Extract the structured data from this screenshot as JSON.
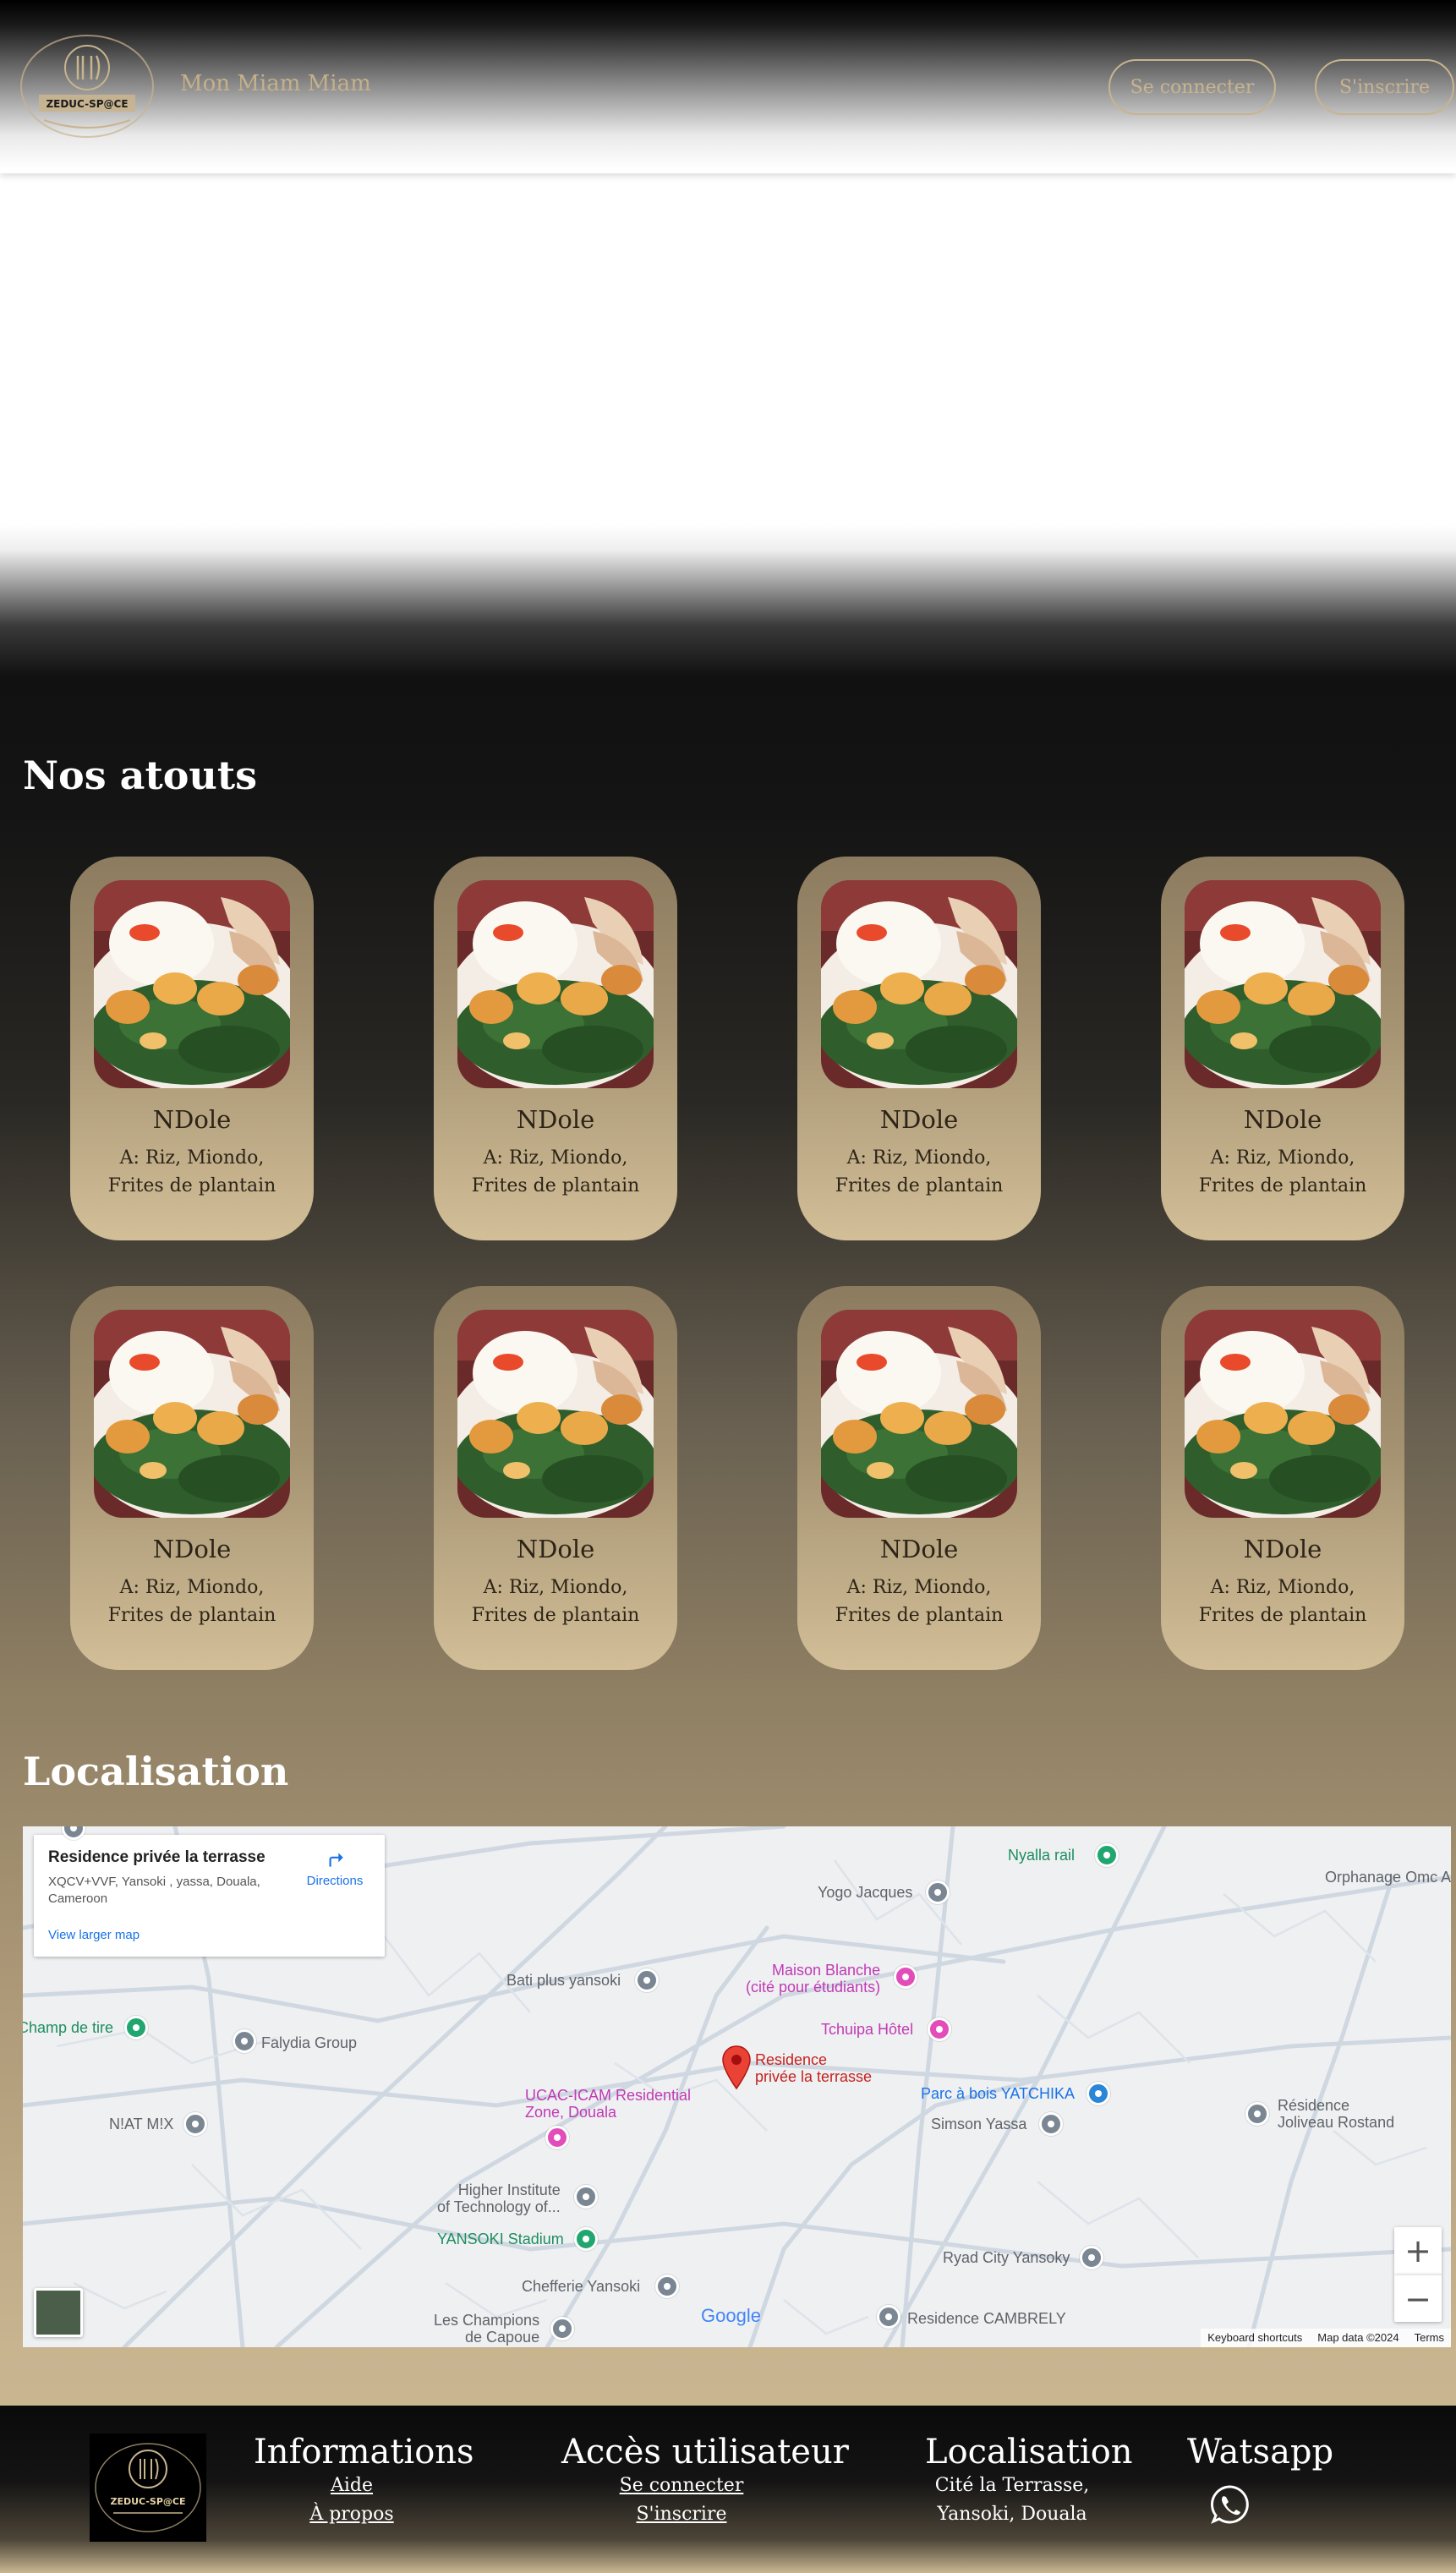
{
  "header": {
    "logo_text": "ZEDUC-SP@CE",
    "brand": "Mon Miam Miam",
    "login_label": "Se connecter",
    "signup_label": "S'inscrire"
  },
  "atouts": {
    "title": "Nos atouts",
    "cards": [
      {
        "name": "NDole",
        "desc": "A: Riz, Miondo, Frites de plantain"
      },
      {
        "name": "NDole",
        "desc": "A: Riz, Miondo, Frites de plantain"
      },
      {
        "name": "NDole",
        "desc": "A: Riz, Miondo, Frites de plantain"
      },
      {
        "name": "NDole",
        "desc": "A: Riz, Miondo, Frites de plantain"
      },
      {
        "name": "NDole",
        "desc": "A: Riz, Miondo, Frites de plantain"
      },
      {
        "name": "NDole",
        "desc": "A: Riz, Miondo, Frites de plantain"
      },
      {
        "name": "NDole",
        "desc": "A: Riz, Miondo, Frites de plantain"
      },
      {
        "name": "NDole",
        "desc": "A: Riz, Miondo, Frites de plantain"
      }
    ]
  },
  "localisation": {
    "title": "Localisation",
    "map": {
      "place_title": "Residence privée la terrasse",
      "place_address": "XQCV+VVF, Yansoki , yassa, Douala, Cameroon",
      "larger_map": "View larger map",
      "directions": "Directions",
      "marker_label_1": "Residence",
      "marker_label_2": "privée la terrasse",
      "pois": {
        "nyalla": "Nyalla rail",
        "yogo": "Yogo Jacques",
        "orphanage": "Orphanage Omc A",
        "bati": "Bati plus yansoki",
        "maison1": "Maison Blanche",
        "maison2": "(cité pour étudiants)",
        "tchuipa": "Tchuipa Hôtel",
        "champ": "Champ de tire",
        "falydia": "Falydia Group",
        "ucac1": "UCAC-ICAM Residential",
        "ucac2": "Zone, Douala",
        "parc": "Parc à bois YATCHIKA",
        "simson": "Simson Yassa",
        "joliveau1": "Résidence",
        "joliveau2": "Joliveau Rostand",
        "niatmix": "N!AT M!X",
        "higher1": "Higher Institute",
        "higher2": "of Technology of...",
        "yansoki": "YANSOKI Stadium",
        "ryad": "Ryad City Yansoky",
        "chefferie": "Chefferie Yansoki",
        "champions1": "Les Champions",
        "champions2": "de Capoue",
        "cambrely": "Residence CAMBRELY"
      },
      "zoom_in": "+",
      "zoom_out": "−",
      "google": "Google",
      "keyboard": "Keyboard shortcuts",
      "map_data": "Map data ©2024",
      "terms": "Terms"
    }
  },
  "footer": {
    "logo_text": "ZEDUC-SP@CE",
    "info_title": "Informations",
    "aide": "Aide",
    "apropos": "À propos",
    "access_title": "Accès utilisateur",
    "login": "Se connecter",
    "signup": "S'inscrire",
    "loc_title": "Localisation",
    "loc_line1": "Cité la Terrasse,",
    "loc_line2": "Yansoki, Douala",
    "whatsapp_title": "Watsapp"
  },
  "colors": {
    "gold": "#c8b48e",
    "card_text": "#2d2418"
  }
}
